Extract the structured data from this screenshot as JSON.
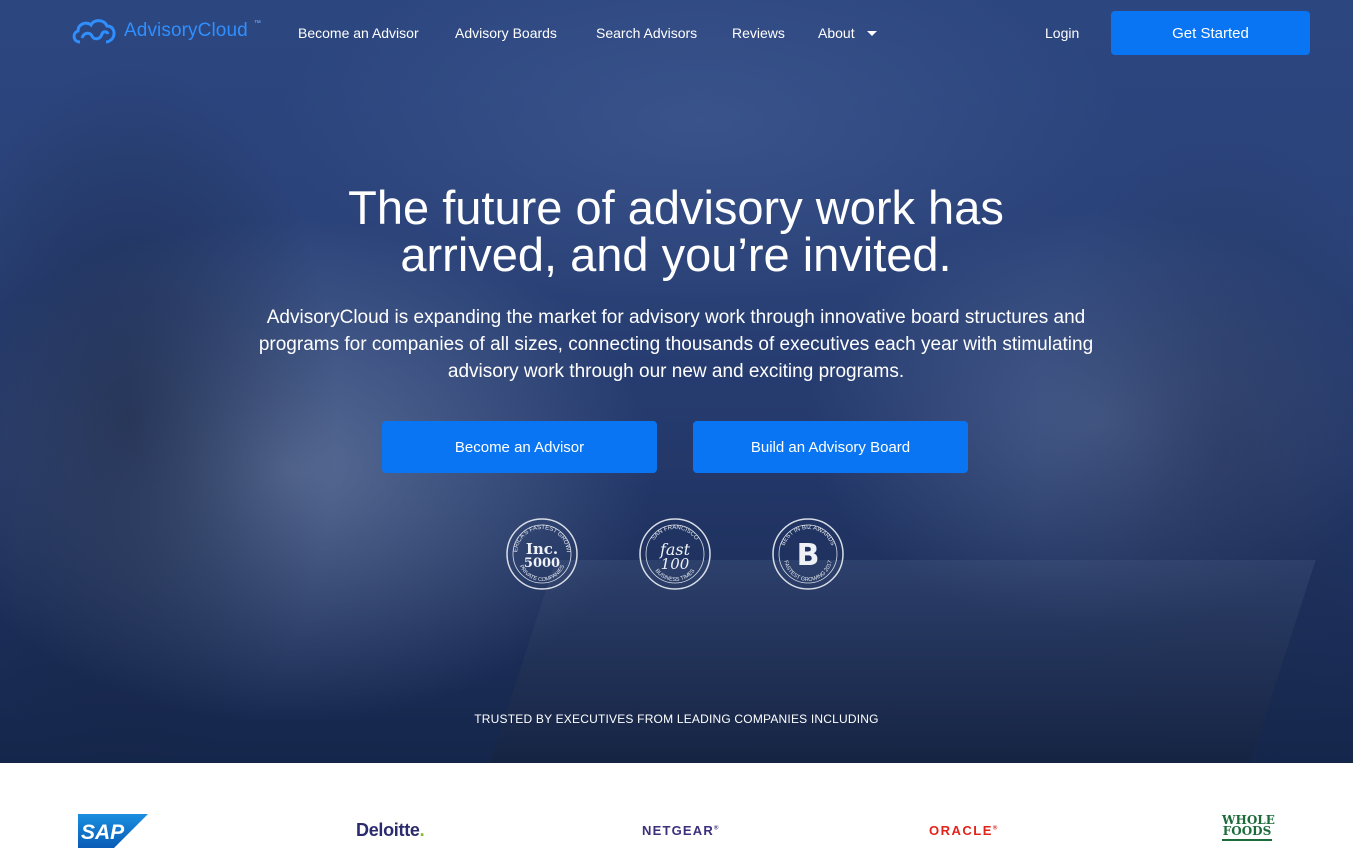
{
  "header": {
    "logo_text": "AdvisoryCloud",
    "logo_tm": "™",
    "nav": {
      "become_advisor": "Become an Advisor",
      "advisory_boards": "Advisory Boards",
      "search_advisors": "Search Advisors",
      "reviews": "Reviews",
      "about": "About"
    },
    "login": "Login",
    "get_started": "Get Started"
  },
  "hero": {
    "headline_line1": "The future of advisory work has",
    "headline_line2": "arrived, and you’re invited.",
    "subtext_line1": "AdvisoryCloud is expanding the market for advisory work through innovative board structures and",
    "subtext_line2": "programs for companies of all sizes, connecting thousands of executives each year with stimulating",
    "subtext_line3": "advisory work through our new and exciting programs.",
    "cta_advisor": "Become an Advisor",
    "cta_board": "Build an Advisory Board",
    "badges": {
      "inc": {
        "top": "AMERICA'S FASTEST GROWING",
        "center1": "Inc.",
        "center2": "5000",
        "bottom": "PRIVATE COMPANIES"
      },
      "fast": {
        "top": "SAN FRANCISCO",
        "center1": "fast",
        "center2": "100",
        "bottom": "BUSINESS TIMES"
      },
      "biz": {
        "top": "BEST IN BIZ AWARDS",
        "center1": "B",
        "bottom": "FASTEST GROWING 2017"
      }
    },
    "trusted": "TRUSTED BY EXECUTIVES FROM LEADING COMPANIES INCLUDING"
  },
  "companies": {
    "sap": "SAP",
    "deloitte": "Deloitte",
    "deloitte_dot": ".",
    "netgear": "NETGEAR",
    "netgear_mark": "®",
    "oracle": "ORACLE",
    "oracle_mark": "®",
    "wholefoods_line1": "WHOLE",
    "wholefoods_line2": "FOODS"
  },
  "colors": {
    "accent_blue": "#0a75f2",
    "logo_blue": "#2f8fff",
    "hero_overlay": "#2a4278"
  }
}
